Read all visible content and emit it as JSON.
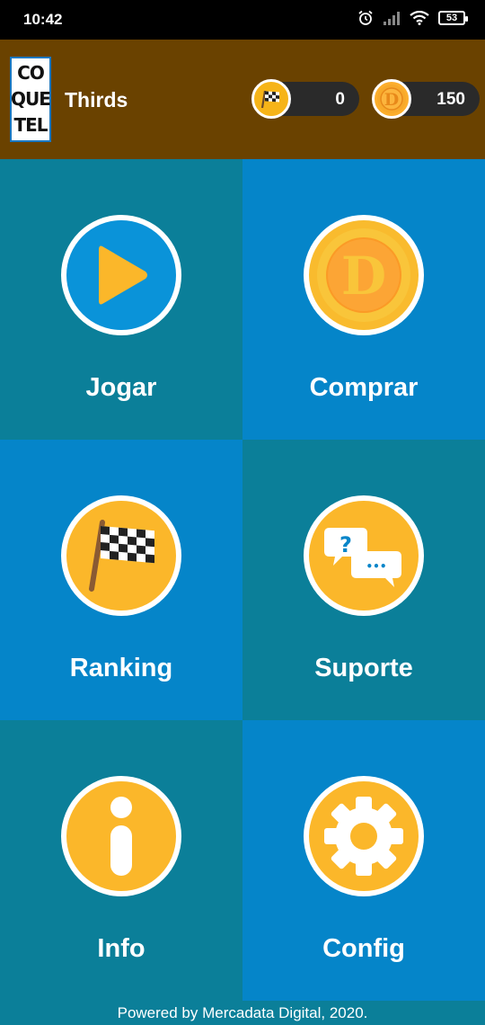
{
  "status_bar": {
    "time": "10:42",
    "battery": "53",
    "icons": [
      "alarm-icon",
      "signal-icon",
      "wifi-icon",
      "battery-icon"
    ]
  },
  "header": {
    "logo_lines": [
      "CO",
      "QUE",
      "TEL"
    ],
    "title": "Thirds",
    "flags_count": "0",
    "coins_count": "150",
    "coin_letter": "D"
  },
  "menu": [
    {
      "label": "Jogar",
      "icon": "play-icon"
    },
    {
      "label": "Comprar",
      "icon": "coin-icon"
    },
    {
      "label": "Ranking",
      "icon": "checkered-flag-icon"
    },
    {
      "label": "Suporte",
      "icon": "chat-bubbles-icon"
    },
    {
      "label": "Info",
      "icon": "info-icon"
    },
    {
      "label": "Config",
      "icon": "gear-icon"
    }
  ],
  "chat_glyphs": {
    "question": "?",
    "dots": "•••"
  },
  "footer": "Powered by Mercadata Digital, 2020.",
  "colors": {
    "teal": "#0b7f99",
    "blue": "#0585c9",
    "header": "#6a4200",
    "accent_yellow": "#f6b418"
  }
}
